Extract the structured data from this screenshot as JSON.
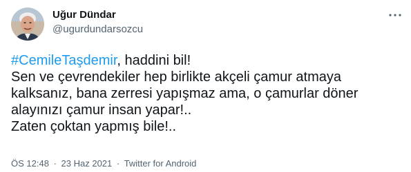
{
  "author": {
    "name": "Uğur Dündar",
    "handle": "@ugurdundarsozcu"
  },
  "tweet": {
    "hashtag": "#CemileTaşdemir",
    "line1_rest": ", haddini bil!",
    "line2": "Sen ve çevrendekiler hep birlikte akçeli çamur atmaya",
    "line3": "kalksanız, bana zerresi yapışmaz ama, o çamurlar döner",
    "line4": "alayınızı çamur insan yapar!..",
    "line5": "Zaten çoktan yapmış bile!.."
  },
  "meta": {
    "time": "ÖS 12:48",
    "separator": "·",
    "date": "23 Haz 2021",
    "source": "Twitter for Android"
  },
  "colors": {
    "hashtag": "#1d9bf0",
    "secondary_text": "#536471",
    "primary_text": "#0f1419"
  },
  "icons": {
    "more": "more-options-icon"
  }
}
